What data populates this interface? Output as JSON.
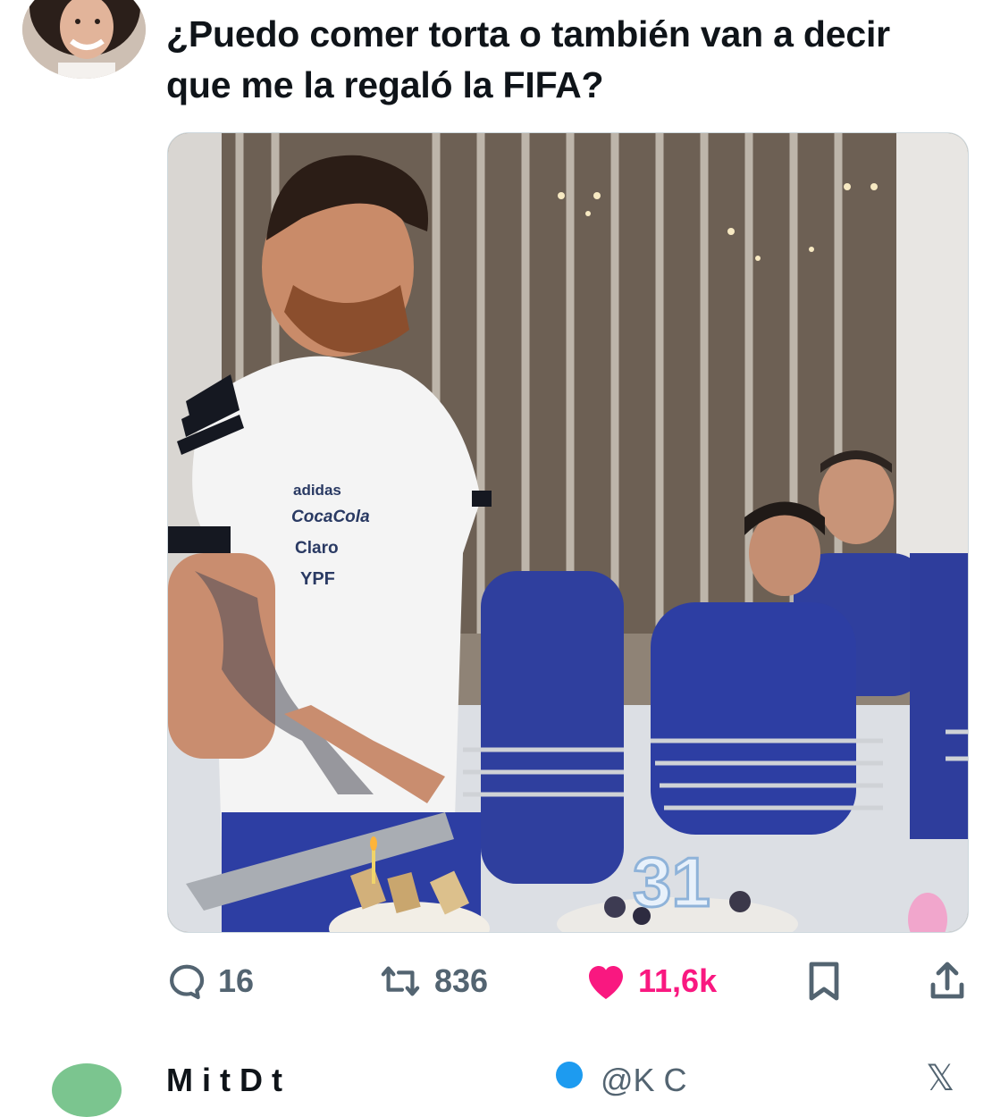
{
  "tweet": {
    "text": "¿Puedo comer torta o también van a decir que me la regaló la FIFA?",
    "image_caption_texts": {
      "shirt_brand": "adidas",
      "shirt_sponsor_1": "Coca-Cola",
      "shirt_sponsor_2": "Claro",
      "shirt_sponsor_3": "YPF",
      "candles": "31"
    }
  },
  "actions": {
    "replies": "16",
    "reposts": "836",
    "likes": "11,6k"
  },
  "colors": {
    "text": "#0f1419",
    "muted": "#536471",
    "like": "#f91880",
    "border": "#cfd9de"
  },
  "next_tweet": {
    "name_partial": "M    i     t    D            t",
    "handle_partial": "@K          C"
  }
}
